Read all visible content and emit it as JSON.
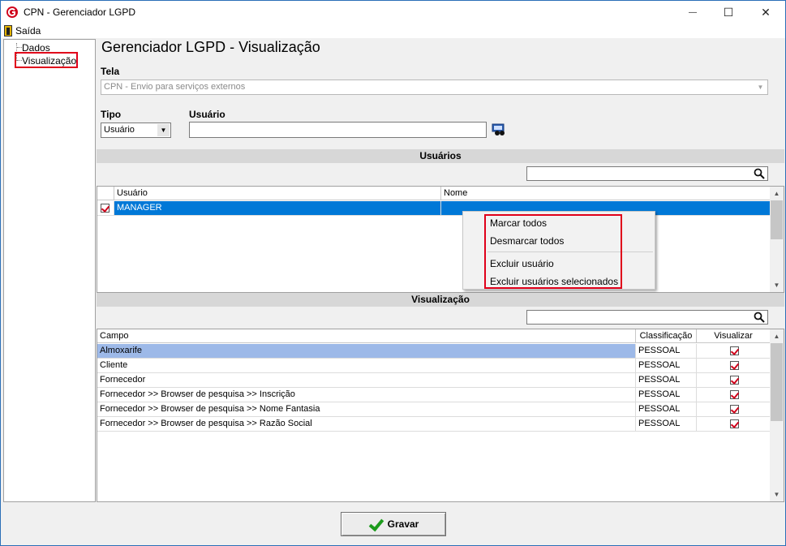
{
  "window": {
    "title": "CPN - Gerenciador LGPD",
    "minimize_glyph": "—",
    "maximize_glyph": "☐",
    "close_glyph": "✕"
  },
  "menubar": {
    "exit_label": "Saída"
  },
  "tree": {
    "items": [
      {
        "label": "Dados"
      },
      {
        "label": "Visualização"
      }
    ]
  },
  "page": {
    "title": "Gerenciador LGPD - Visualização"
  },
  "form": {
    "tela_label": "Tela",
    "tela_value": "CPN - Envio para serviços externos",
    "tipo_label": "Tipo",
    "tipo_value": "Usuário",
    "usuario_label": "Usuário",
    "usuario_value": ""
  },
  "users_section": {
    "title": "Usuários",
    "search_value": "",
    "columns": [
      "Usuário",
      "Nome"
    ],
    "rows": [
      {
        "checked": true,
        "usuario": "MANAGER",
        "nome": ""
      }
    ]
  },
  "context_menu": {
    "items": [
      "Marcar todos",
      "Desmarcar todos",
      "Excluir usuário",
      "Excluir usuários selecionados"
    ]
  },
  "view_section": {
    "title": "Visualização",
    "search_value": "",
    "columns": [
      "Campo",
      "Classificação",
      "Visualizar"
    ],
    "rows": [
      {
        "campo": "Almoxarife",
        "classificacao": "PESSOAL",
        "visualizar": true
      },
      {
        "campo": "Cliente",
        "classificacao": "PESSOAL",
        "visualizar": true
      },
      {
        "campo": "Fornecedor",
        "classificacao": "PESSOAL",
        "visualizar": true
      },
      {
        "campo": "Fornecedor >> Browser de pesquisa >> Inscrição",
        "classificacao": "PESSOAL",
        "visualizar": true
      },
      {
        "campo": "Fornecedor >> Browser de pesquisa >> Nome Fantasia",
        "classificacao": "PESSOAL",
        "visualizar": true
      },
      {
        "campo": "Fornecedor >> Browser de pesquisa >> Razão Social",
        "classificacao": "PESSOAL",
        "visualizar": true
      }
    ]
  },
  "footer": {
    "save_label": "Gravar"
  },
  "colors": {
    "selected_row": "#0078d7",
    "highlight_row": "#9db9e8",
    "annotation_red": "#e0001a"
  }
}
